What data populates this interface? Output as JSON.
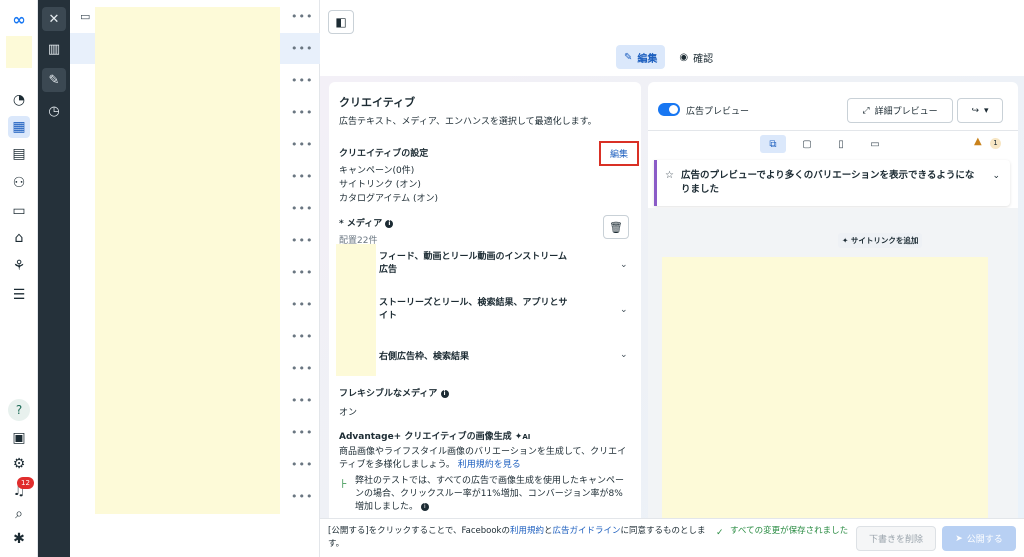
{
  "rail": {
    "icons": [
      "meta-logo-icon",
      "gauge-icon",
      "table-icon",
      "pages-icon",
      "people-icon",
      "billing-icon",
      "megaphone-icon",
      "network-icon",
      "menu-icon",
      "help-icon",
      "news-icon",
      "gear-icon",
      "bell-icon",
      "search-icon",
      "bug-icon"
    ],
    "notification_count": "12"
  },
  "toolbar": {
    "tabs": [
      {
        "label": "編集",
        "active": true
      },
      {
        "label": "確認",
        "active": false
      }
    ]
  },
  "creative": {
    "title": "クリエイティブ",
    "subtitle": "広告テキスト、メディア、エンハンスを選択して最適化します。",
    "settings_title": "クリエイティブの設定",
    "edit_label": "編集",
    "settings_lines": [
      "キャンペーン(0件)",
      "サイトリンク (オン)",
      "カタログアイテム (オン)"
    ],
    "media_title": "* メディア",
    "media_count": "配置22件",
    "media_rows": [
      "フィード、動画とリール動画のインストリーム広告",
      "ストーリーズとリール、検索結果、アプリとサイト",
      "右側広告枠、検索結果"
    ],
    "flex_title": "フレキシブルなメディア",
    "flex_value": "オン",
    "adv_title": "Advantage+ クリエイティブの画像生成",
    "adv_ai": "AI",
    "adv_desc": "商品画像やライフスタイル画像のバリエーションを生成して、クリエイティブを多様化しましょう。",
    "adv_link": "利用規約を見る",
    "stat_text": "弊社のテストでは、すべての広告で画像生成を使用したキャンペーンの場合、クリックスルー率が11%増加、コンバージョン率が8%増加しました。"
  },
  "preview": {
    "toggle_label": "広告プレビュー",
    "toggle_on": true,
    "detail_button": "詳細プレビュー",
    "warning_count": "1",
    "notice": "広告のプレビューでより多くのバリエーションを表示できるようになりました",
    "sitelink_label": "サイトリンクを追加"
  },
  "footer": {
    "message_prefix": "[公開する]をクリックすることで、Facebookの",
    "terms_link": "利用規約",
    "message_mid": "と",
    "guidelines_link": "広告ガイドライン",
    "message_suffix": "に同意するものとします。",
    "saved_status": "すべての変更が保存されました",
    "discard_button": "下書きを削除",
    "publish_button": "公開する"
  },
  "colors": {
    "accent": "#1877f2",
    "highlight_border": "#d93025",
    "placeholder": "#fdfad8",
    "dark_panel": "#25313a",
    "success": "#2a8c43"
  }
}
